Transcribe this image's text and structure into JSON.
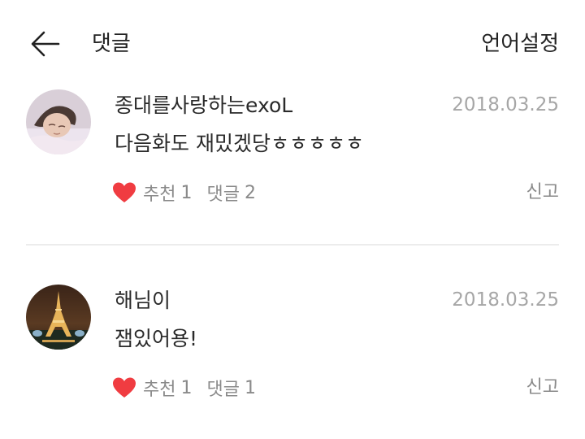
{
  "header": {
    "title": "댓글",
    "language_label": "언어설정",
    "back_icon": "arrow-left-icon"
  },
  "comments": [
    {
      "author": "종대를사랑하는exoL",
      "date": "2018.03.25",
      "text": "다음화도 재밌겠당ㅎㅎㅎㅎㅎ",
      "like_label": "추천",
      "like_count": "1",
      "reply_label": "댓글",
      "reply_count": "2",
      "report_label": "신고",
      "avatar_icon": "person-photo",
      "like_icon": "heart-icon"
    },
    {
      "author": "해님이",
      "date": "2018.03.25",
      "text": "잼있어용!",
      "like_label": "추천",
      "like_count": "1",
      "reply_label": "댓글",
      "reply_count": "1",
      "report_label": "신고",
      "avatar_icon": "eiffel-tower-photo",
      "like_icon": "heart-icon"
    }
  ],
  "colors": {
    "text_primary": "#2a2a2a",
    "text_secondary": "#8a8a8a",
    "date_gray": "#a6a6a6",
    "heart_red": "#f03c41",
    "divider": "#ececec"
  }
}
